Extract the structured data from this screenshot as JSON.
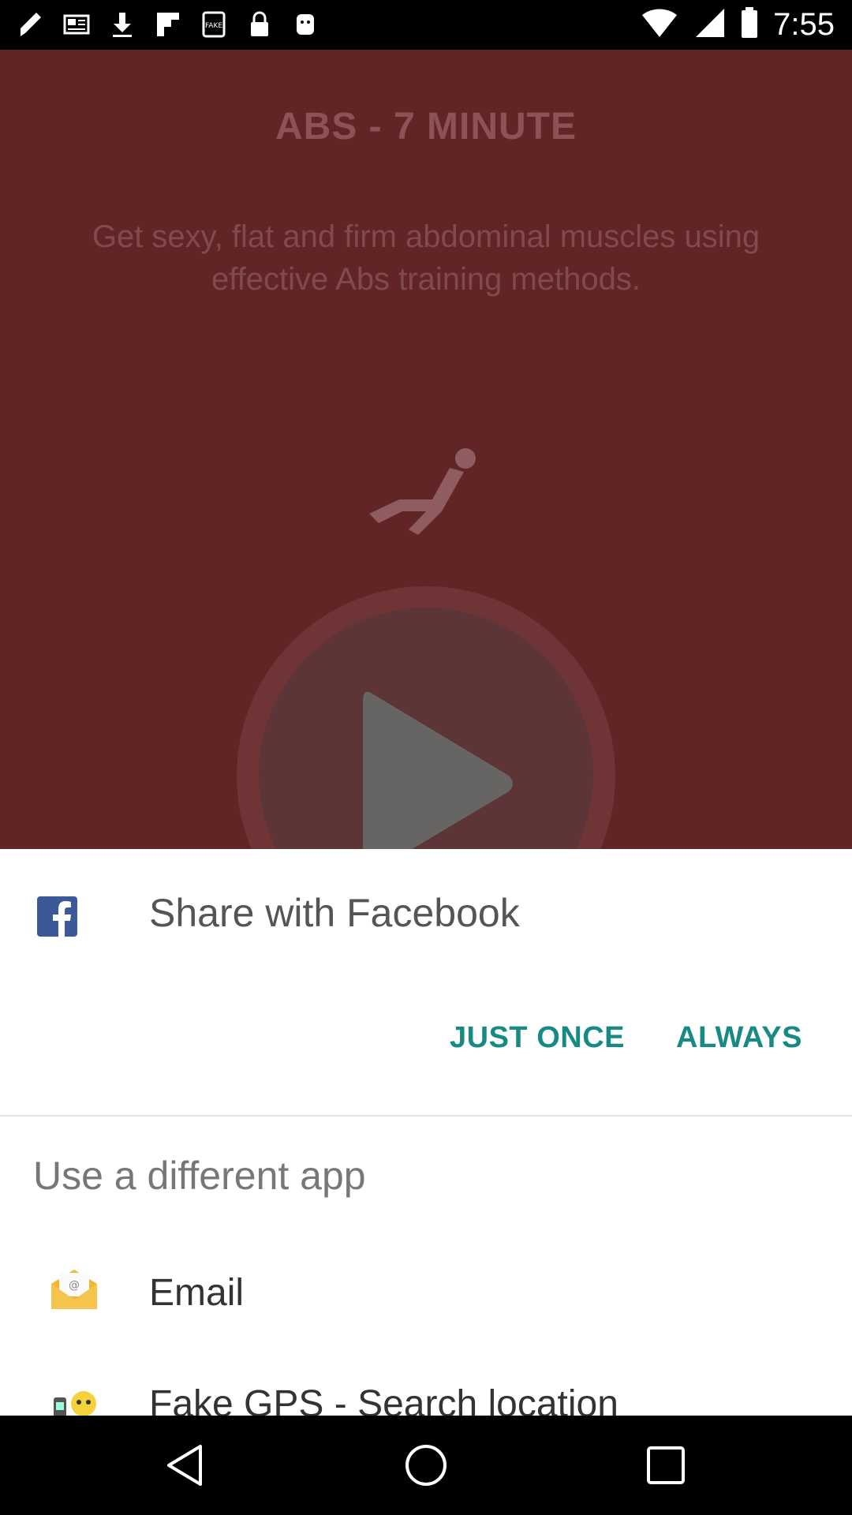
{
  "status_bar": {
    "time": "7:55",
    "icons": [
      "notification-icon",
      "news-icon",
      "download-icon",
      "flipboard-icon",
      "fake-gps-icon",
      "lock-icon",
      "android-icon",
      "wifi-icon",
      "signal-icon",
      "battery-icon"
    ]
  },
  "app_background": {
    "title": "ABS - 7 MINUTE",
    "description": "Get sexy, flat and firm abdominal muscles using effective Abs training methods."
  },
  "share_sheet": {
    "title": "Share with Facebook",
    "just_once_label": "JUST ONCE",
    "always_label": "ALWAYS",
    "different_app_label": "Use a different app",
    "apps": [
      {
        "label": "Email",
        "icon": "email-icon"
      },
      {
        "label": "Fake GPS - Search location",
        "icon": "fake-gps-app-icon"
      }
    ]
  },
  "nav_bar": {
    "icons": [
      "back-icon",
      "home-icon",
      "recents-icon"
    ]
  },
  "colors": {
    "app_bg": "#622526",
    "accent": "#188a84",
    "facebook": "#3b5998"
  }
}
